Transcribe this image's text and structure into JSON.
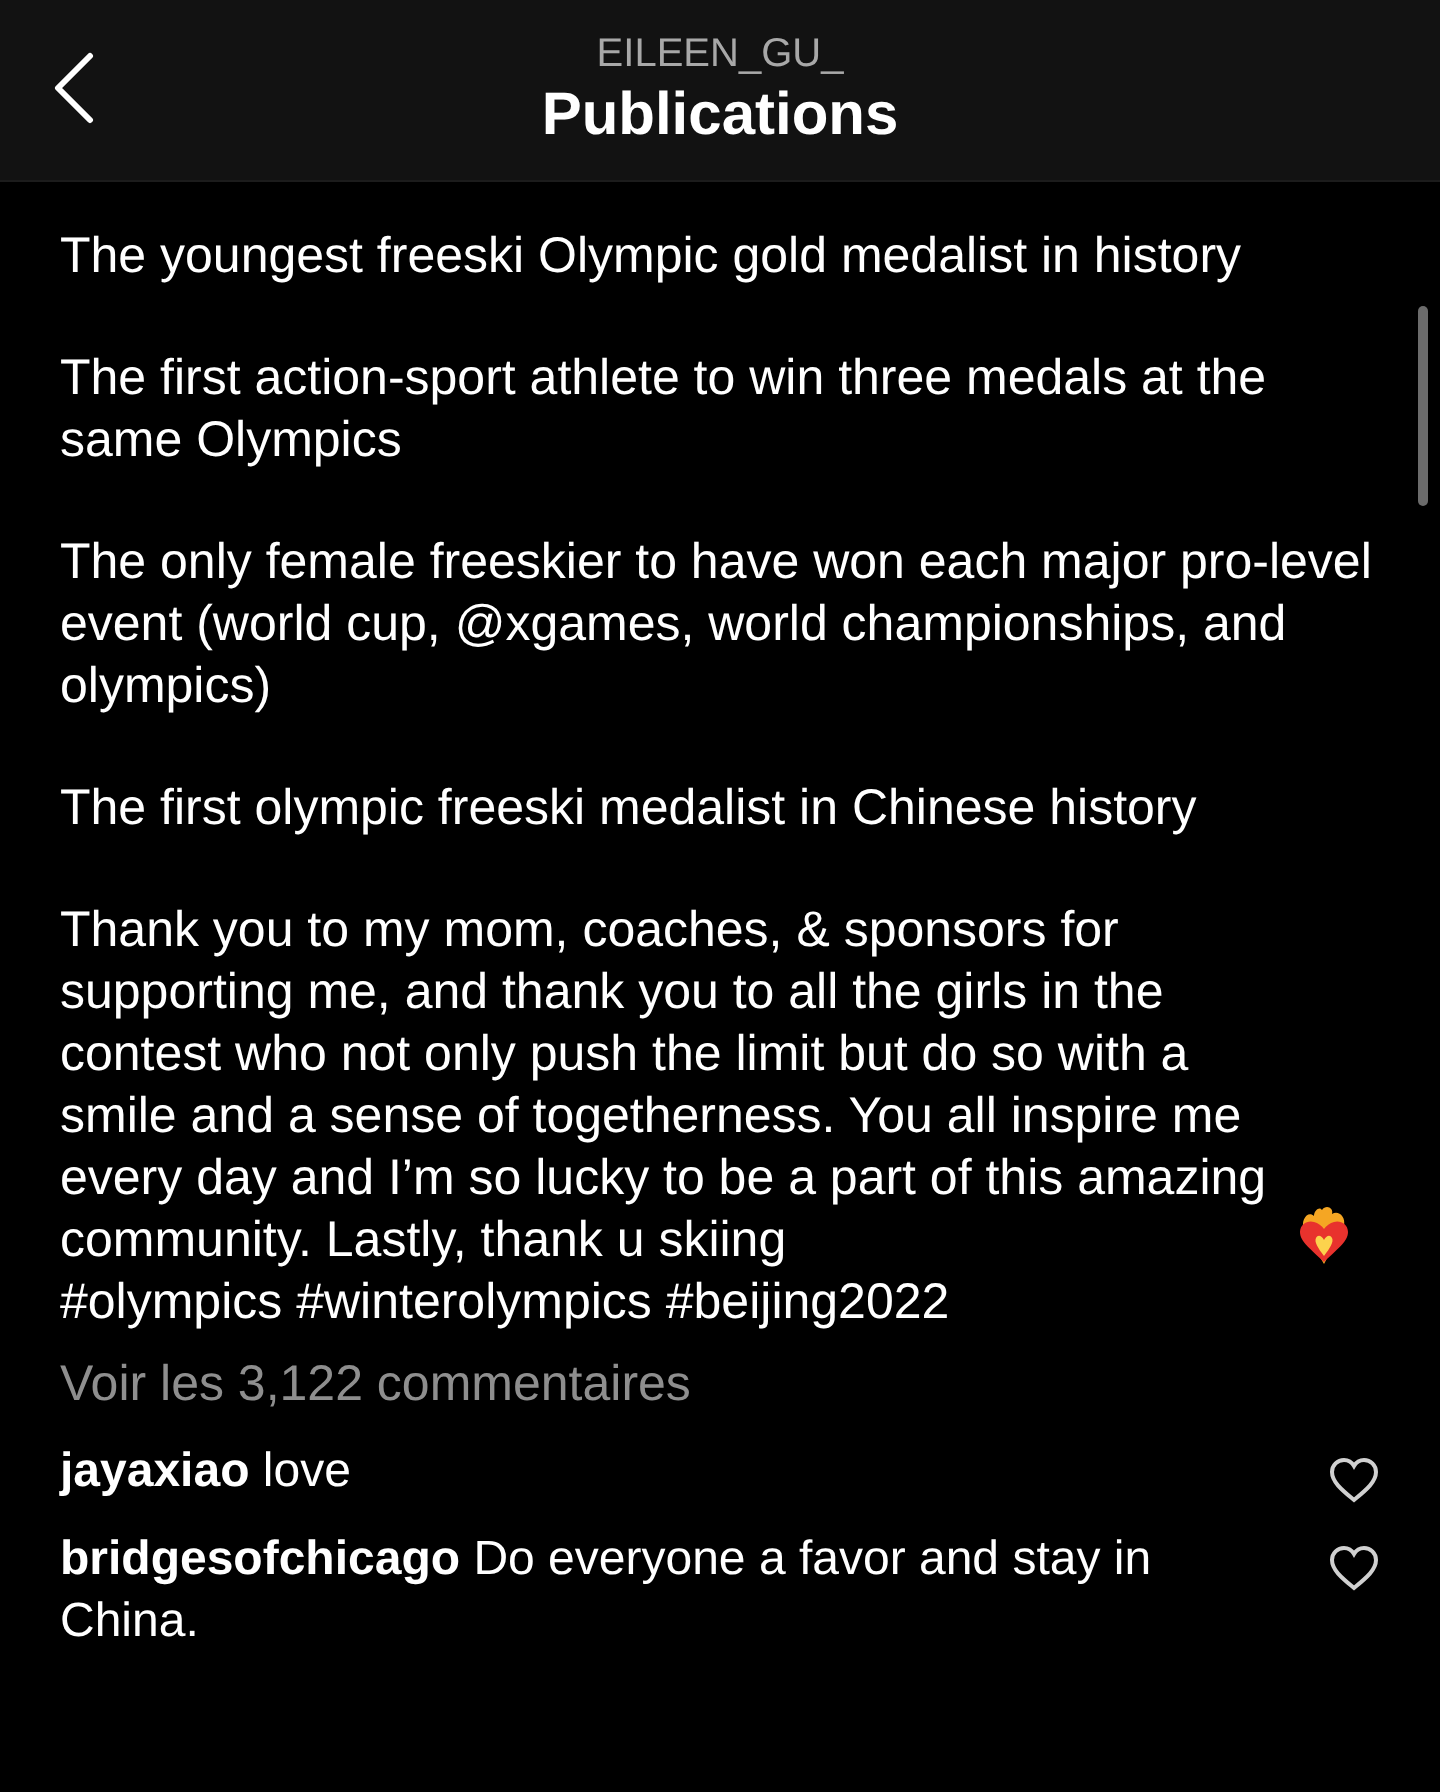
{
  "header": {
    "account": "EILEEN_GU_",
    "title": "Publications"
  },
  "caption": {
    "paragraphs": [
      "The youngest freeski Olympic gold medalist in history",
      "The first action-sport athlete to win three medals at the same Olympics",
      "The only female freeskier to have won each major pro-level event (world cup, @xgames, world championships, and olympics)",
      "The first olympic freeski medalist in Chinese history",
      "Thank you to my mom, coaches, & sponsors for supporting me, and thank you to all the girls in the contest who not only push the limit but do so with a smile and a sense of togetherness. You all inspire me every day and I’m so lucky to be a part of this amazing community. Lastly, thank u skiing"
    ],
    "hashtags": "#olympics #winterolympics #beijing2022"
  },
  "view_comments": "Voir les 3,122 commentaires",
  "comments": [
    {
      "user": "jayaxiao",
      "text": "love"
    },
    {
      "user": "bridgesofchicago",
      "text": "Do everyone a favor and stay in China."
    }
  ]
}
